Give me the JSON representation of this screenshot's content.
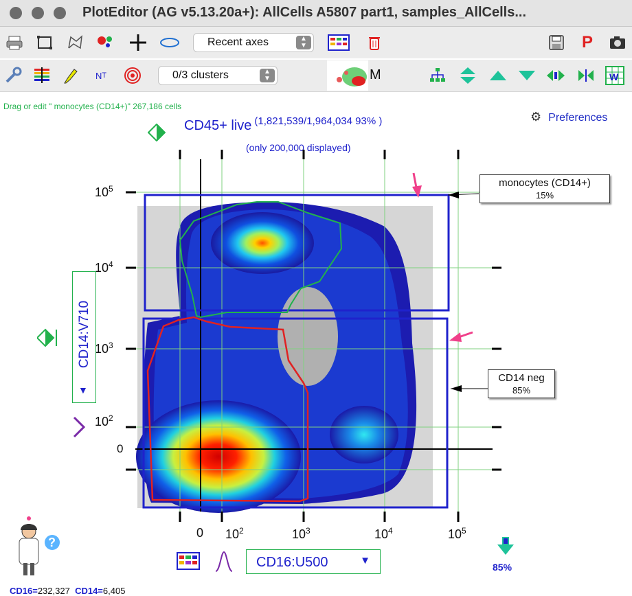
{
  "window": {
    "title": "PlotEditor (AG v5.13.20a+): AllCells A5807 part1, samples_AllCells..."
  },
  "toolbar1": {
    "recent_axes": "Recent axes"
  },
  "toolbar2": {
    "clusters": "0/3 clusters",
    "m_label": "M"
  },
  "status_text": "Drag or edit \" monocytes (CD14+)\" 267,186 cells",
  "preferences_label": "Preferences",
  "plot": {
    "title": "CD45+ live",
    "count": "(1,821,539/1,964,034 93% )",
    "subtitle": "(only 200,000 displayed)",
    "y_axis_label": "CD14:V710",
    "x_axis_label": "CD16:U500",
    "y_ticks": [
      "10",
      "10",
      "10",
      "10",
      "0"
    ],
    "y_tick_exps": [
      "5",
      "4",
      "3",
      "2",
      ""
    ],
    "x_ticks": [
      "0",
      "10",
      "10",
      "10",
      "10"
    ],
    "x_tick_exps": [
      "",
      "2",
      "3",
      "4",
      "5"
    ]
  },
  "gates": [
    {
      "name": "monocytes (CD14+)",
      "pct": "15%"
    },
    {
      "name": "CD14 neg",
      "pct": "85%"
    }
  ],
  "x_percent": "85%",
  "footer": {
    "cd16_label": "CD16=",
    "cd16_value": "232,327",
    "cd14_label": "CD14=",
    "cd14_value": "6,405"
  },
  "colors": {
    "gate_blue": "#1f22cc",
    "green": "#22b14c",
    "red": "#e02222"
  }
}
